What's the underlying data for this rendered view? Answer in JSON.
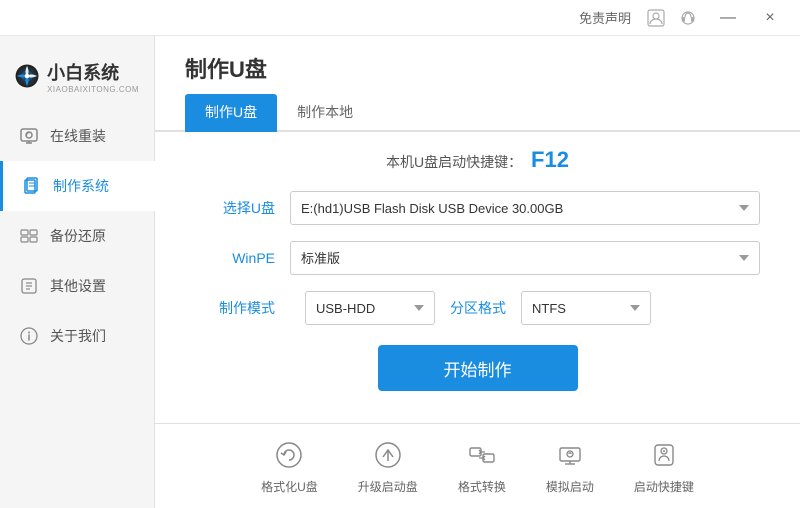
{
  "titlebar": {
    "free_label": "免责声明",
    "minimize": "—",
    "close": "×"
  },
  "logo": {
    "text": "小白系统",
    "sub": "XIAOBAIXITONG.COM"
  },
  "sidebar": {
    "items": [
      {
        "id": "online-reinstall",
        "label": "在线重装",
        "active": false
      },
      {
        "id": "make-system",
        "label": "制作系统",
        "active": true
      },
      {
        "id": "backup-restore",
        "label": "备份还原",
        "active": false
      },
      {
        "id": "other-settings",
        "label": "其他设置",
        "active": false
      },
      {
        "id": "about-us",
        "label": "关于我们",
        "active": false
      }
    ]
  },
  "page": {
    "title": "制作U盘",
    "tabs": [
      {
        "id": "make-usb",
        "label": "制作U盘",
        "active": true
      },
      {
        "id": "make-local",
        "label": "制作本地",
        "active": false
      }
    ]
  },
  "content": {
    "shortcut_hint": "本机U盘启动快捷键：",
    "shortcut_key": "F12",
    "form": {
      "usb_label": "选择U盘",
      "usb_value": "E:(hd1)USB Flash Disk USB Device 30.00GB",
      "winpe_label": "WinPE",
      "winpe_value": "标准版",
      "mode_label": "制作模式",
      "mode_value": "USB-HDD",
      "partition_label": "分区格式",
      "partition_value": "NTFS"
    },
    "start_button": "开始制作"
  },
  "bottom_tools": [
    {
      "id": "format-usb",
      "label": "格式化U盘"
    },
    {
      "id": "upgrade-boot",
      "label": "升级启动盘"
    },
    {
      "id": "format-convert",
      "label": "格式转换"
    },
    {
      "id": "simulate-boot",
      "label": "模拟启动"
    },
    {
      "id": "boot-shortcut",
      "label": "启动快捷键"
    }
  ]
}
